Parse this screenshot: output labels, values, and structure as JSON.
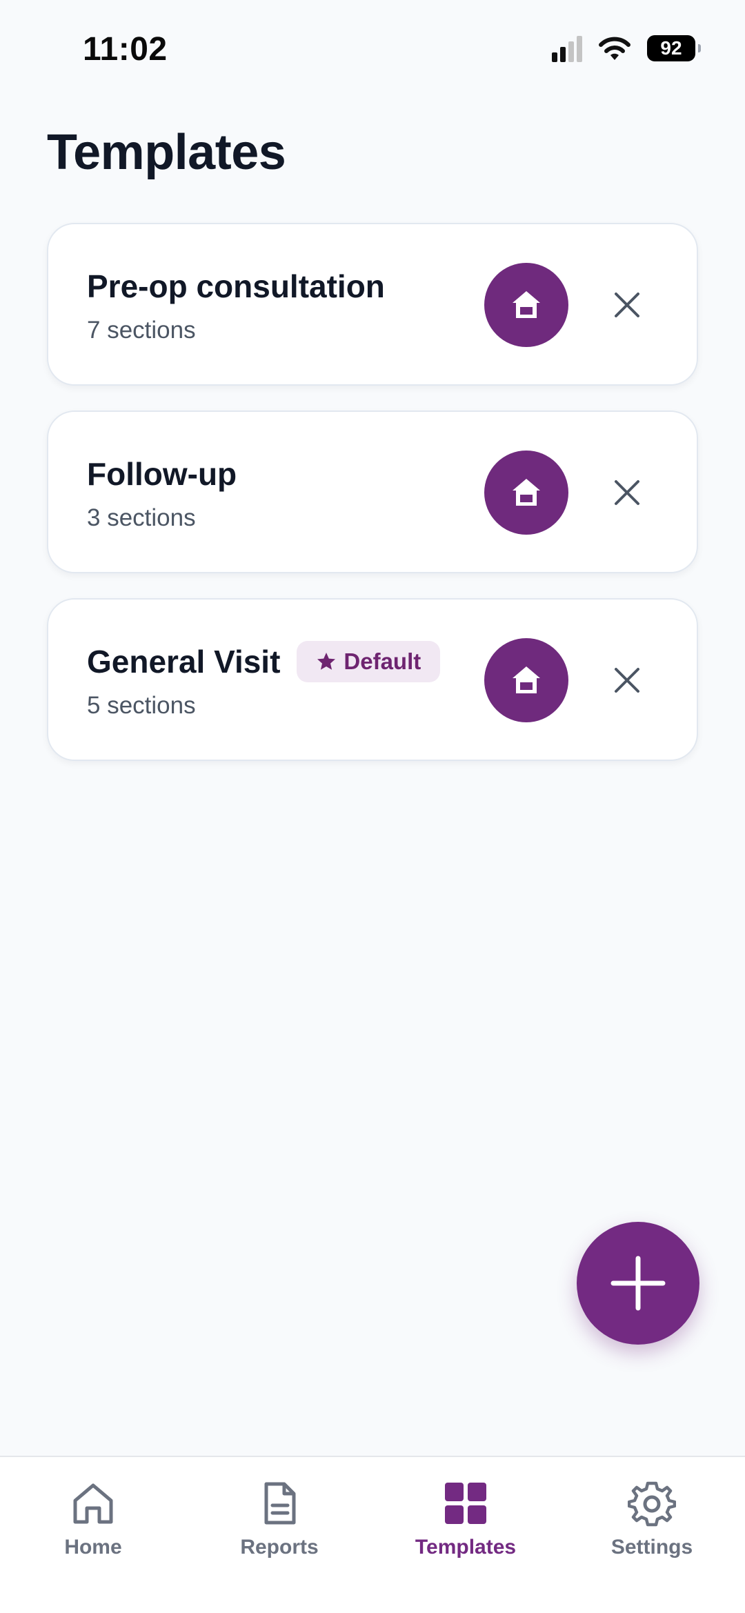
{
  "status_bar": {
    "time": "11:02",
    "battery": "92"
  },
  "page": {
    "title": "Templates"
  },
  "templates": [
    {
      "name": "Pre-op consultation",
      "sections": "7 sections",
      "is_default": false,
      "badge": ""
    },
    {
      "name": "Follow-up",
      "sections": "3 sections",
      "is_default": false,
      "badge": ""
    },
    {
      "name": "General Visit",
      "sections": "5 sections",
      "is_default": true,
      "badge": "Default"
    }
  ],
  "icons": {
    "card_action": "home-icon",
    "card_remove": "close-icon",
    "default_badge": "star-icon",
    "fab": "plus-icon"
  },
  "tab_bar": {
    "items": [
      {
        "label": "Home",
        "icon": "home-icon",
        "active": false
      },
      {
        "label": "Reports",
        "icon": "document-icon",
        "active": false
      },
      {
        "label": "Templates",
        "icon": "grid-icon",
        "active": true
      },
      {
        "label": "Settings",
        "icon": "gear-icon",
        "active": false
      }
    ]
  },
  "colors": {
    "accent": "#732a82",
    "badge_bg": "#f1e8f3",
    "card_border": "#e2e8f0",
    "background": "#f8fafc",
    "inactive_tab": "#6b7280"
  }
}
